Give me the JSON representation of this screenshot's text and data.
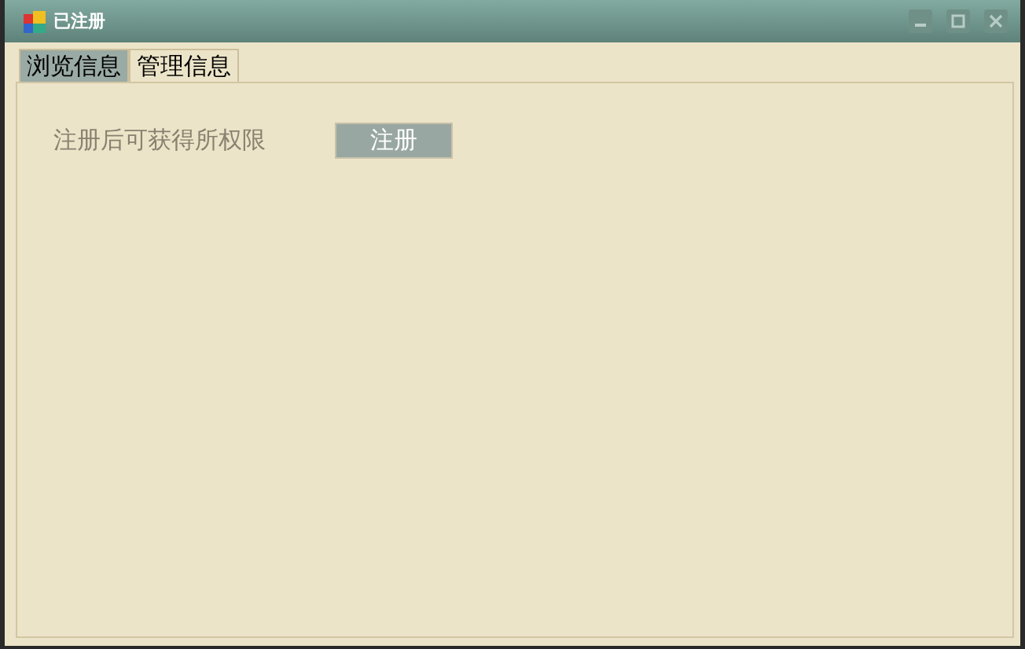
{
  "window": {
    "title": "已注册"
  },
  "tabs": [
    {
      "label": "浏览信息",
      "selected": true
    },
    {
      "label": "管理信息",
      "selected": false
    }
  ],
  "content": {
    "message": "注册后可获得所权限",
    "button": "注册"
  }
}
